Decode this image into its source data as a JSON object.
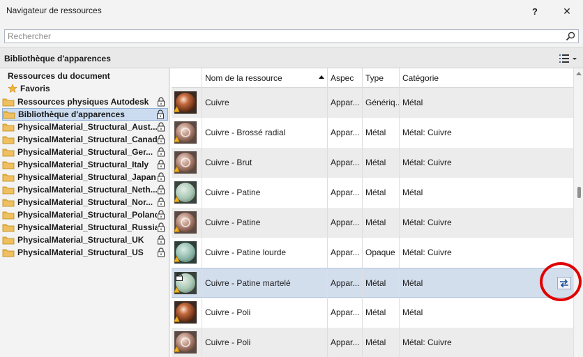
{
  "window": {
    "title": "Navigateur de ressources",
    "help_label": "?",
    "close_label": "✕"
  },
  "search": {
    "placeholder": "Rechercher",
    "value": ""
  },
  "library_bar": {
    "title": "Bibliothèque d'apparences",
    "view_icon": "list-view-icon"
  },
  "left_panel": {
    "document_resources_label": "Ressources du document",
    "favorites_label": "Favoris",
    "items": [
      {
        "label": "Ressources physiques Autodesk",
        "locked": true,
        "selected": false
      },
      {
        "label": "Bibliothèque d'apparences",
        "locked": true,
        "selected": true
      },
      {
        "label": "PhysicalMaterial_Structural_Aust...",
        "locked": true,
        "selected": false
      },
      {
        "label": "PhysicalMaterial_Structural_Canada",
        "locked": true,
        "selected": false
      },
      {
        "label": "PhysicalMaterial_Structural_Ger...",
        "locked": true,
        "selected": false
      },
      {
        "label": "PhysicalMaterial_Structural_Italy",
        "locked": true,
        "selected": false
      },
      {
        "label": "PhysicalMaterial_Structural_Japan",
        "locked": true,
        "selected": false
      },
      {
        "label": "PhysicalMaterial_Structural_Neth...",
        "locked": true,
        "selected": false
      },
      {
        "label": "PhysicalMaterial_Structural_Nor...",
        "locked": true,
        "selected": false
      },
      {
        "label": "PhysicalMaterial_Structural_Poland",
        "locked": true,
        "selected": false
      },
      {
        "label": "PhysicalMaterial_Structural_Russia",
        "locked": true,
        "selected": false
      },
      {
        "label": "PhysicalMaterial_Structural_UK",
        "locked": true,
        "selected": false
      },
      {
        "label": "PhysicalMaterial_Structural_US",
        "locked": true,
        "selected": false
      }
    ]
  },
  "table": {
    "columns": [
      "Nom de la ressource",
      "Aspec",
      "Type",
      "Catégorie"
    ],
    "rows": [
      {
        "name": "Cuivre",
        "aspect": "Appar...",
        "type": "Génériq...",
        "category": "Métal",
        "swatch": "copper",
        "selected": false
      },
      {
        "name": "Cuivre - Brossé radial",
        "aspect": "Appar...",
        "type": "Métal",
        "category": "Métal: Cuivre",
        "swatch": "brushed",
        "selected": false
      },
      {
        "name": "Cuivre - Brut",
        "aspect": "Appar...",
        "type": "Métal",
        "category": "Métal: Cuivre",
        "swatch": "brushed",
        "selected": false
      },
      {
        "name": "Cuivre - Patine",
        "aspect": "Appar...",
        "type": "Métal",
        "category": "Métal",
        "swatch": "patina",
        "selected": false
      },
      {
        "name": "Cuivre - Patine",
        "aspect": "Appar...",
        "type": "Métal",
        "category": "Métal: Cuivre",
        "swatch": "brushed",
        "selected": false
      },
      {
        "name": "Cuivre - Patine lourde",
        "aspect": "Appar...",
        "type": "Opaque",
        "category": "Métal: Cuivre",
        "swatch": "heavy-patina",
        "selected": false
      },
      {
        "name": "Cuivre - Patine martelé",
        "aspect": "Appar...",
        "type": "Métal",
        "category": "Métal",
        "swatch": "patina",
        "selected": true
      },
      {
        "name": "Cuivre - Poli",
        "aspect": "Appar...",
        "type": "Métal",
        "category": "Métal",
        "swatch": "copper",
        "selected": false
      },
      {
        "name": "Cuivre - Poli",
        "aspect": "Appar...",
        "type": "Métal",
        "category": "Métal: Cuivre",
        "swatch": "brushed",
        "selected": false
      }
    ]
  },
  "colors": {
    "selection": "#d3deed",
    "alt_row": "#ececec",
    "copper": "#c56a3d",
    "patina": "#a9c7b4",
    "highlight_ring": "#e00000",
    "folder": "#f0c060"
  }
}
